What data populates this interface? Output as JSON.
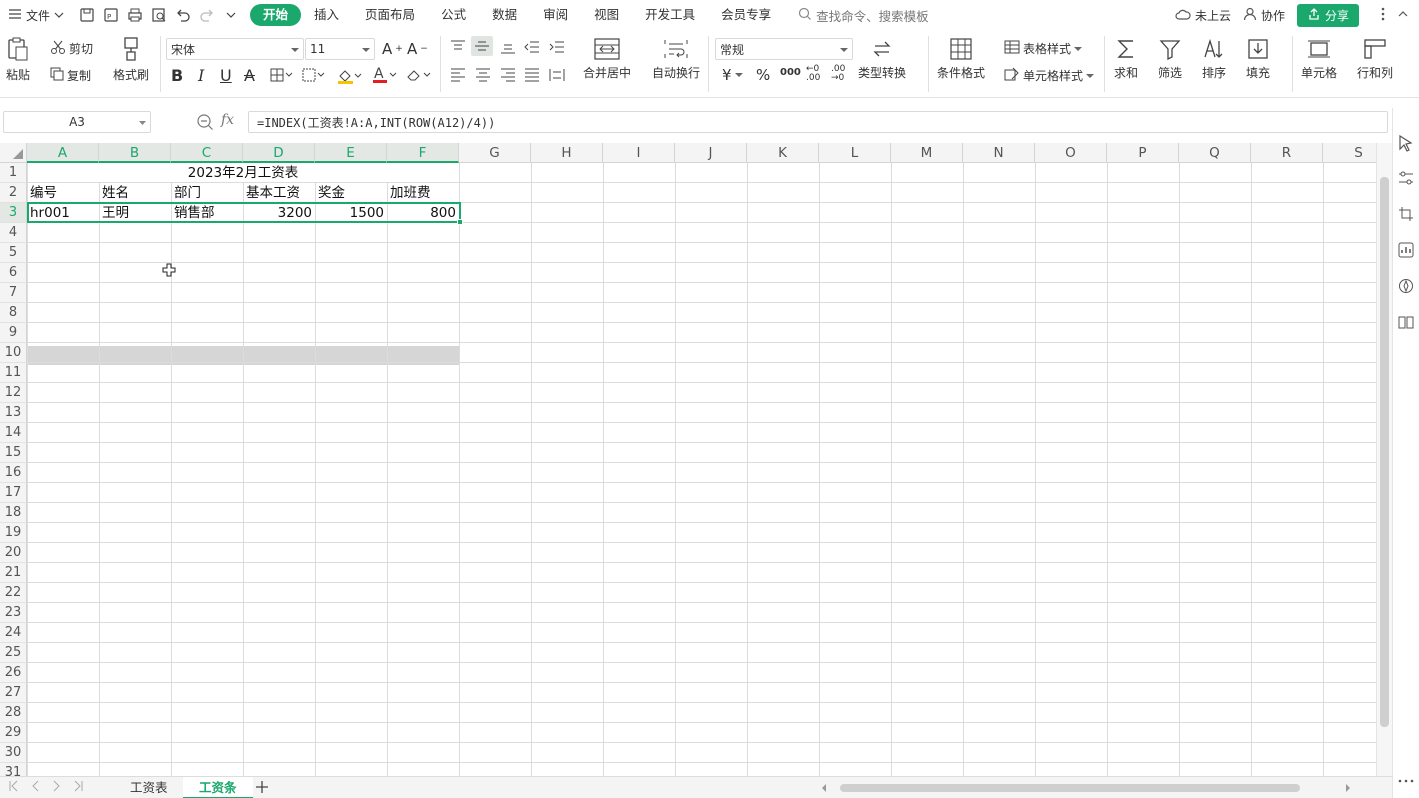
{
  "menubar": {
    "file_label": "文件",
    "tabs": [
      {
        "label": "开始"
      },
      {
        "label": "插入"
      },
      {
        "label": "页面布局"
      },
      {
        "label": "公式"
      },
      {
        "label": "数据"
      },
      {
        "label": "审阅"
      },
      {
        "label": "视图"
      },
      {
        "label": "开发工具"
      },
      {
        "label": "会员专享"
      }
    ],
    "search_placeholder": "查找命令、搜索模板",
    "cloud_label": "未上云",
    "collab_label": "协作",
    "share_label": "分享"
  },
  "ribbon": {
    "paste": "粘贴",
    "cut": "剪切",
    "copy": "复制",
    "format_painter": "格式刷",
    "font_name": "宋体",
    "font_size": "11",
    "merge_center": "合并居中",
    "wrap_text": "自动换行",
    "number_format": "常规",
    "type_convert": "类型转换",
    "cond_format": "条件格式",
    "table_style": "表格样式",
    "cell_style": "单元格样式",
    "sum": "求和",
    "filter": "筛选",
    "sort": "排序",
    "fill": "填充",
    "cell": "单元格",
    "row_col": "行和列"
  },
  "formula_bar": {
    "name_box": "A3",
    "fx": "fx",
    "formula": "=INDEX(工资表!A:A,INT(ROW(A12)/4))"
  },
  "grid": {
    "columns": [
      "A",
      "B",
      "C",
      "D",
      "E",
      "F",
      "G",
      "H",
      "I",
      "J",
      "K",
      "L",
      "M",
      "N",
      "O",
      "P",
      "Q",
      "R",
      "S"
    ],
    "rows": [
      "1",
      "2",
      "3",
      "4",
      "5",
      "6",
      "7",
      "8",
      "9",
      "10",
      "11",
      "12",
      "13",
      "14",
      "15",
      "16",
      "17",
      "18",
      "19",
      "20",
      "21",
      "22",
      "23",
      "24",
      "25",
      "26",
      "27",
      "28",
      "29",
      "30",
      "31"
    ],
    "title": "2023年2月工资表",
    "headers": [
      "编号",
      "姓名",
      "部门",
      "基本工资",
      "奖金",
      "加班费"
    ],
    "record": [
      "hr001",
      "王明",
      "销售部",
      "3200",
      "1500",
      "800"
    ]
  },
  "sheets": [
    {
      "label": "工资表"
    },
    {
      "label": "工资条"
    }
  ],
  "colors": {
    "accent": "#1aa86c"
  }
}
